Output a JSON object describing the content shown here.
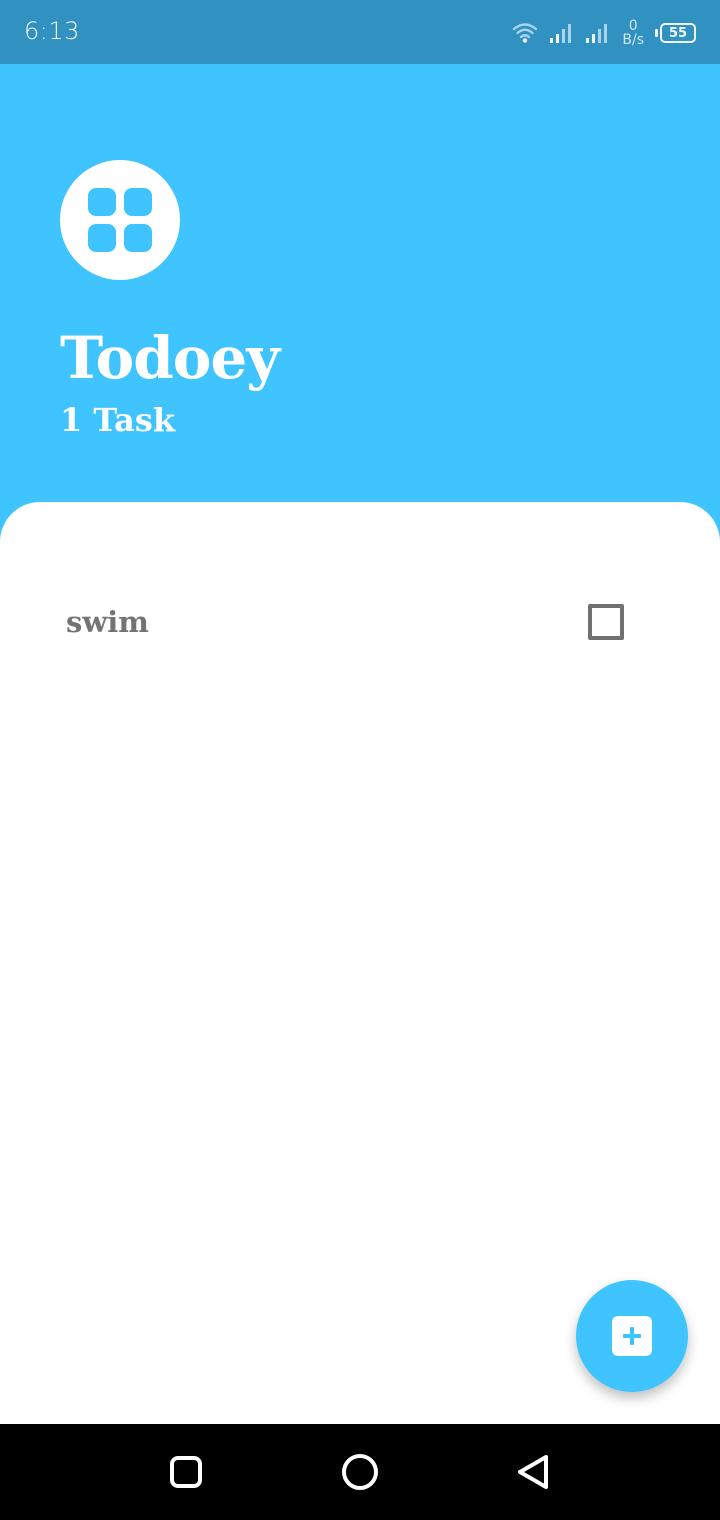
{
  "status_bar": {
    "time": "6:13",
    "net_speed_value": "0",
    "net_speed_unit": "B/s",
    "battery_level": "55",
    "icons": [
      "wifi-icon",
      "signal-icon",
      "signal-icon",
      "battery-icon"
    ]
  },
  "header": {
    "logo_icon": "grid-icon",
    "title": "Todoey",
    "task_count": "1 Task"
  },
  "tasks": [
    {
      "label": "swim",
      "checked": false
    }
  ],
  "fab": {
    "icon": "plus-icon"
  },
  "nav_bar": {
    "icons": [
      "recents-square-icon",
      "home-circle-icon",
      "back-triangle-icon"
    ]
  },
  "colors": {
    "accent": "#40C4FF",
    "status_bar": "#3191C1",
    "panel": "#FFFFFF",
    "task_text": "#737373",
    "nav_bar": "#000000"
  }
}
